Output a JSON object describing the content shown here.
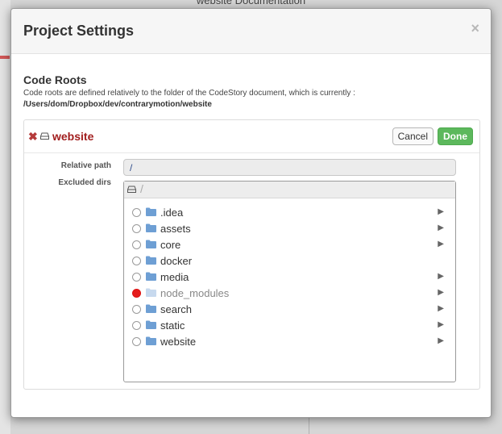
{
  "background": {
    "title": "website Documentation"
  },
  "modal": {
    "title": "Project Settings",
    "close_glyph": "×"
  },
  "code_roots": {
    "title": "Code Roots",
    "description": "Code roots are defined relatively to the folder of the CodeStory document, which is currently :",
    "current_path": "/Users/dom/Dropbox/dev/contrarymotion/website"
  },
  "root": {
    "remove_glyph": "✖",
    "name": "website",
    "cancel_label": "Cancel",
    "done_label": "Done",
    "relative_path_label": "Relative path",
    "relative_path_value": "/",
    "excluded_dirs_label": "Excluded dirs",
    "breadcrumb": "/",
    "dirs": [
      {
        "name": ".idea",
        "excluded": false,
        "has_children": true
      },
      {
        "name": "assets",
        "excluded": false,
        "has_children": true
      },
      {
        "name": "core",
        "excluded": false,
        "has_children": true
      },
      {
        "name": "docker",
        "excluded": false,
        "has_children": false
      },
      {
        "name": "media",
        "excluded": false,
        "has_children": true
      },
      {
        "name": "node_modules",
        "excluded": true,
        "has_children": true
      },
      {
        "name": "search",
        "excluded": false,
        "has_children": true
      },
      {
        "name": "static",
        "excluded": false,
        "has_children": true
      },
      {
        "name": "website",
        "excluded": false,
        "has_children": true
      }
    ]
  },
  "colors": {
    "excluded_radio": "#e51c1c",
    "folder": "#6e9fd4",
    "folder_excluded": "#c7d9ee",
    "done_button": "#5cb85c",
    "root_name": "#a11d1d"
  },
  "icons": {
    "remove": "x-icon",
    "drive": "drive-icon",
    "folder": "folder-icon",
    "expand": "triangle-right-icon",
    "close": "close-icon"
  }
}
